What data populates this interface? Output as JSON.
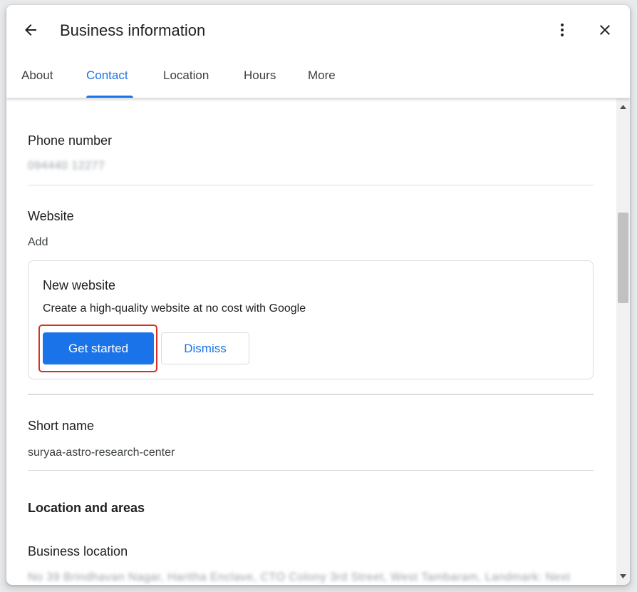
{
  "header": {
    "title": "Business information",
    "back_icon": "arrow-back-icon",
    "more_icon": "more-vert-icon",
    "close_icon": "close-icon"
  },
  "tabs": [
    {
      "label": "About",
      "active": false
    },
    {
      "label": "Contact",
      "active": true
    },
    {
      "label": "Location",
      "active": false
    },
    {
      "label": "Hours",
      "active": false
    },
    {
      "label": "More",
      "active": false
    }
  ],
  "contact": {
    "phone_label": "Phone number",
    "phone_value": "094440 12277",
    "website_label": "Website",
    "website_value": "Add",
    "new_website_card": {
      "title": "New website",
      "description": "Create a high-quality website at no cost with Google",
      "primary_button": "Get started",
      "secondary_button": "Dismiss"
    },
    "short_name_label": "Short name",
    "short_name_value": "suryaa-astro-research-center"
  },
  "location": {
    "heading": "Location and areas",
    "business_location_label": "Business location",
    "business_location_value": "No 39 Brindhavan Nagar, Haritha Enclave, CTO Colony 3rd Street, West Tambaram, Landmark: Next"
  },
  "colors": {
    "accent": "#1a73e8",
    "highlight": "#d93025",
    "divider": "#dadce0"
  }
}
